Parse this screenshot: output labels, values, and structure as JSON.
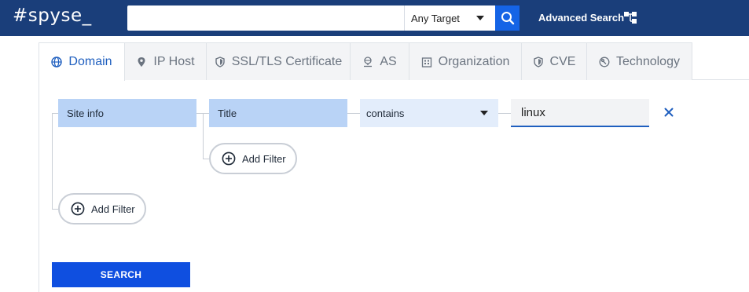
{
  "header": {
    "logo": "#spyse_",
    "search": {
      "value": "",
      "placeholder": ""
    },
    "target_select": "Any Target",
    "advanced_search": "Advanced Search"
  },
  "tabs": [
    {
      "label": "Domain",
      "icon": "globe-icon",
      "active": true
    },
    {
      "label": "IP Host",
      "icon": "map-pin-icon",
      "active": false
    },
    {
      "label": "SSL/TLS Certificate",
      "icon": "shield-icon",
      "active": false
    },
    {
      "label": "AS",
      "icon": "network-icon",
      "active": false
    },
    {
      "label": "Organization",
      "icon": "building-icon",
      "active": false
    },
    {
      "label": "CVE",
      "icon": "shield-icon",
      "active": false
    },
    {
      "label": "Technology",
      "icon": "wrench-icon",
      "active": false
    }
  ],
  "filter": {
    "group_label": "Site info",
    "field_label": "Title",
    "operator": "contains",
    "value": "linux",
    "add_filter_inner": "Add Filter",
    "add_filter_outer": "Add Filter"
  },
  "search_button": "SEARCH",
  "colors": {
    "header_bg": "#1a3e7a",
    "accent": "#1564e6",
    "chip_bg": "#b9d3f6",
    "active_tab_text": "#1f5fbf"
  }
}
